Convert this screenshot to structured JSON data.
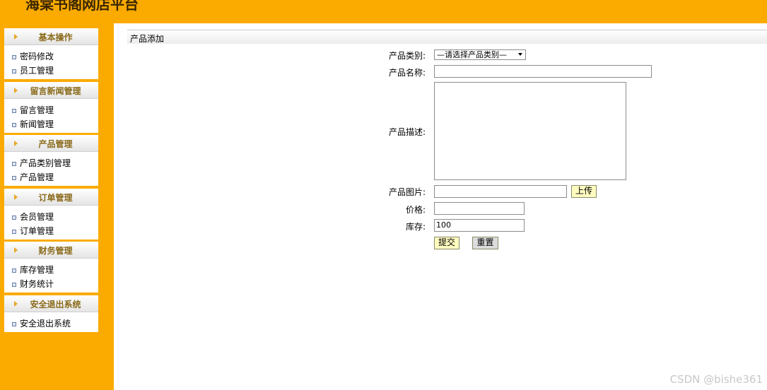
{
  "header": {
    "title": "海棠书阁网店平台"
  },
  "colors": {
    "accent": "#fbab00",
    "menu_title": "#8a6a1a",
    "button_yellow": "#fffcc0",
    "button_gray": "#dcdcdc"
  },
  "sidebar": {
    "groups": [
      {
        "title": "基本操作",
        "items": [
          "密码修改",
          "员工管理"
        ]
      },
      {
        "title": "留言新闻管理",
        "items": [
          "留言管理",
          "新闻管理"
        ]
      },
      {
        "title": "产品管理",
        "items": [
          "产品类别管理",
          "产品管理"
        ]
      },
      {
        "title": "订单管理",
        "items": [
          "会员管理",
          "订单管理"
        ]
      },
      {
        "title": "财务管理",
        "items": [
          "库存管理",
          "财务统计"
        ]
      },
      {
        "title": "安全退出系统",
        "items": [
          "安全退出系统"
        ]
      }
    ]
  },
  "main": {
    "panel_title": "产品添加",
    "form": {
      "category_label": "产品类别:",
      "category_selected": "—请选择产品类别—",
      "name_label": "产品名称:",
      "name_value": "",
      "description_label": "产品描述:",
      "description_value": "",
      "image_label": "产品图片:",
      "image_value": "",
      "upload_button": "上传",
      "price_label": "价格:",
      "price_value": "",
      "stock_label": "库存:",
      "stock_value": "100",
      "submit_button": "提交",
      "reset_button": "重置"
    }
  },
  "watermark": "CSDN @bishe361"
}
